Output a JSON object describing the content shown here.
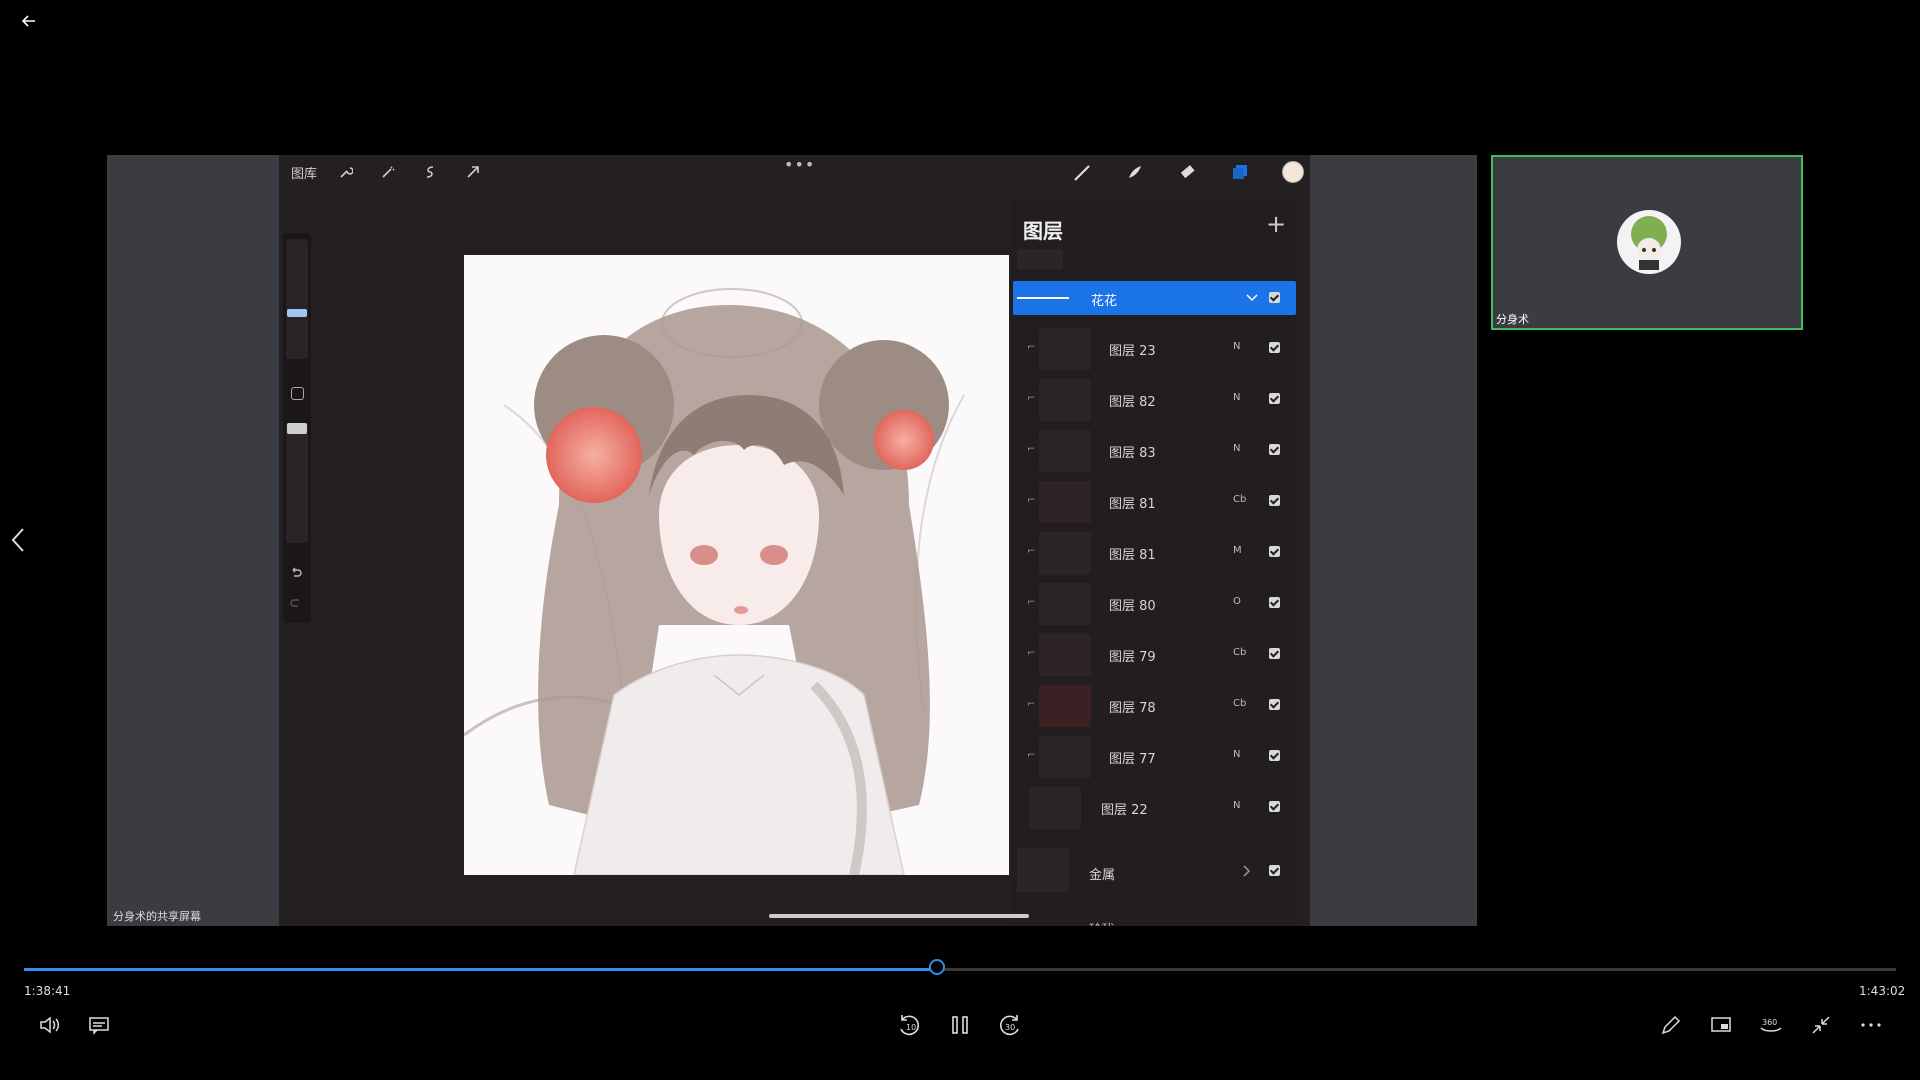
{
  "share": {
    "label": "分身术的共享屏幕"
  },
  "procreate": {
    "gallery_label": "图库",
    "more_dots": "•••",
    "layers_title": "图层",
    "add_symbol": "+",
    "group_flower": "花花",
    "layers": [
      {
        "name": "图层 23",
        "mode": "N"
      },
      {
        "name": "图层 82",
        "mode": "N"
      },
      {
        "name": "图层 83",
        "mode": "N"
      },
      {
        "name": "图层 81",
        "mode": "Cb"
      },
      {
        "name": "图层 81",
        "mode": "M"
      },
      {
        "name": "图层 80",
        "mode": "O"
      },
      {
        "name": "图层 79",
        "mode": "Cb"
      },
      {
        "name": "图层 78",
        "mode": "Cb"
      },
      {
        "name": "图层 77",
        "mode": "N"
      },
      {
        "name": "图层 22",
        "mode": "N"
      }
    ],
    "group_metal": "金属",
    "group_partial": "玲珑"
  },
  "participant": {
    "name": "分身术"
  },
  "playback": {
    "current_time": "1:38:41",
    "total_time": "1:43:02",
    "progress": 0.4875,
    "skip_back": "10",
    "skip_forward": "30",
    "degree_label": "360"
  },
  "colors": {
    "accent": "#2f8fe6",
    "layer_selected": "#1b73e8",
    "speaker_border": "#3fbd5c"
  }
}
